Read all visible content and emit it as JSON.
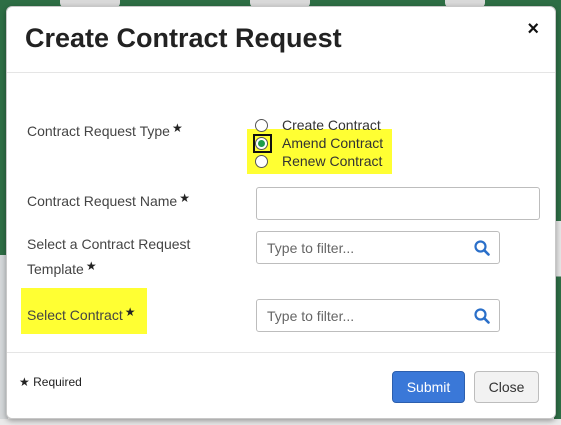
{
  "dialog": {
    "title": "Create Contract Request",
    "close_glyph": "×"
  },
  "form": {
    "required_star": "★",
    "type": {
      "label": "Contract Request Type",
      "options": [
        {
          "label": "Create Contract",
          "selected": false
        },
        {
          "label": "Amend Contract",
          "selected": true
        },
        {
          "label": "Renew Contract",
          "selected": false
        }
      ]
    },
    "name": {
      "label": "Contract Request Name",
      "value": "",
      "placeholder": ""
    },
    "template": {
      "label_line1": "Select a Contract Request",
      "label_line2": "Template",
      "placeholder": "Type to filter..."
    },
    "contract": {
      "label": "Select Contract",
      "placeholder": "Type to filter..."
    }
  },
  "footer": {
    "required_star": "★",
    "required_label": "Required",
    "submit_label": "Submit",
    "close_label": "Close"
  },
  "colors": {
    "highlight": "#ffff33",
    "primary_button": "#3a78d8",
    "radio_selected": "#1e9e4a",
    "backdrop_green": "#2e6e45"
  },
  "icons": {
    "search": "search-icon",
    "close": "close-icon",
    "required": "star-icon"
  }
}
